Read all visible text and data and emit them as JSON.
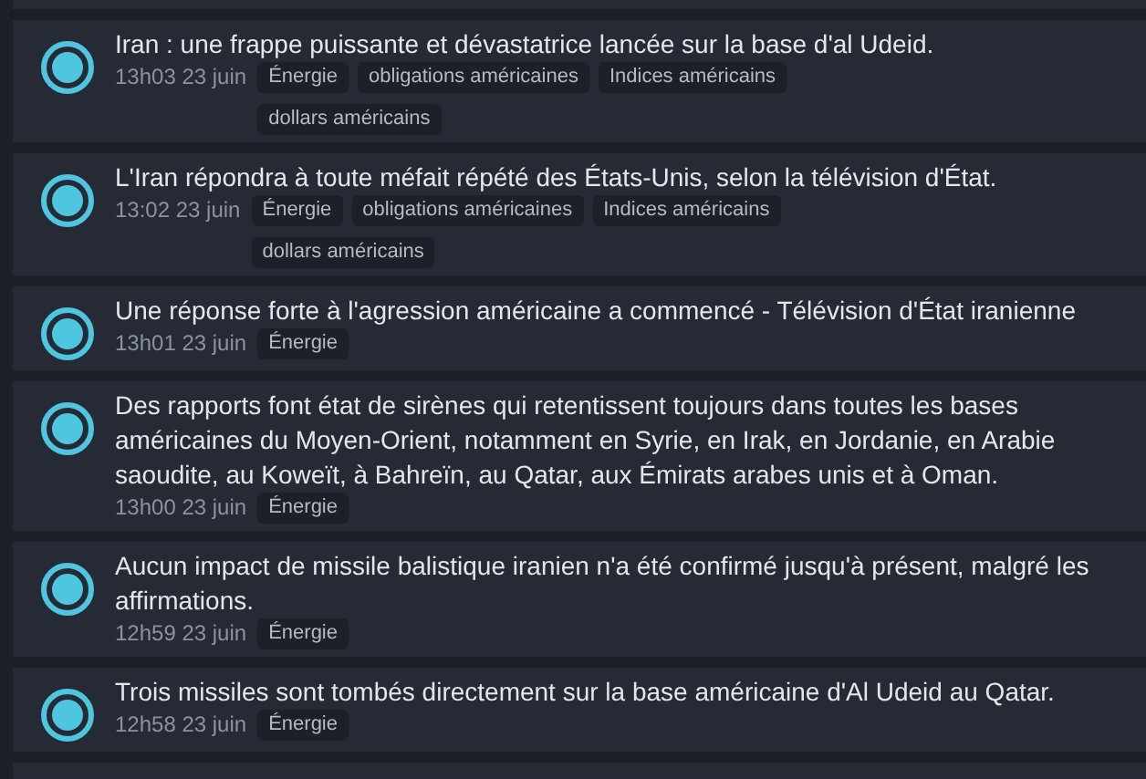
{
  "news": [
    {
      "headline": "Iran : une frappe puissante et dévastatrice lancée sur la base d'al Udeid.",
      "time": "13h03 23 juin",
      "tags": [
        "Énergie",
        "obligations américaines",
        "Indices américains",
        "dollars américains"
      ]
    },
    {
      "headline": "L'Iran répondra à toute méfait répété des États-Unis, selon la télévision d'État.",
      "time": "13:02 23 juin",
      "tags": [
        "Énergie",
        "obligations américaines",
        "Indices américains",
        "dollars américains"
      ]
    },
    {
      "headline": "Une réponse forte à l'agression américaine a commencé - Télévision d'État iranienne",
      "time": "13h01 23 juin",
      "tags": [
        "Énergie"
      ]
    },
    {
      "headline": "Des rapports font état de sirènes qui retentissent toujours dans toutes les bases américaines du Moyen-Orient, notamment en Syrie, en Irak, en Jordanie, en Arabie saoudite, au Koweït, à Bahreïn, au Qatar, aux Émirats arabes unis et à Oman.",
      "time": "13h00 23 juin",
      "tags": [
        "Énergie"
      ]
    },
    {
      "headline": "Aucun impact de missile balistique iranien n'a été confirmé jusqu'à présent, malgré les affirmations.",
      "time": "12h59 23 juin",
      "tags": [
        "Énergie"
      ]
    },
    {
      "headline": "Trois missiles sont tombés directement sur la base américaine d'Al Udeid au Qatar.",
      "time": "12h58 23 juin",
      "tags": [
        "Énergie"
      ]
    }
  ]
}
